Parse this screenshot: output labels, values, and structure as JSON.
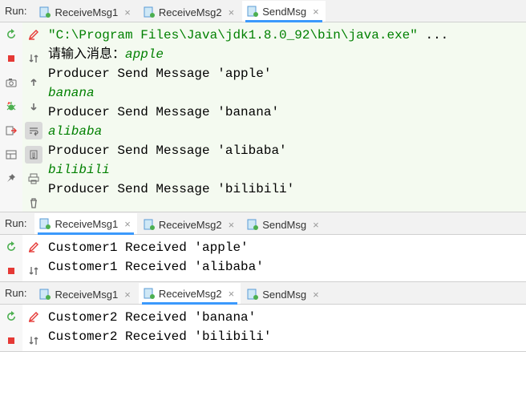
{
  "panels": [
    {
      "runLabel": "Run:",
      "tabs": [
        {
          "label": "ReceiveMsg1",
          "active": false
        },
        {
          "label": "ReceiveMsg2",
          "active": false
        },
        {
          "label": "SendMsg",
          "active": true
        }
      ],
      "hl": true,
      "leftTools": [
        "rerun",
        "stop",
        "camera",
        "bug",
        "exit",
        "layout",
        "pin"
      ],
      "rightTools": [
        "pen",
        "sort",
        "up",
        "down",
        "wrap",
        "scroll",
        "print",
        "trash"
      ],
      "selectedRight": [
        4,
        5
      ],
      "lines": [
        {
          "segs": [
            {
              "cls": "t-str",
              "text": "\"C:\\Program Files\\Java\\jdk1.8.0_92\\bin\\java.exe\""
            },
            {
              "cls": "t-black",
              "text": " ..."
            }
          ]
        },
        {
          "segs": [
            {
              "cls": "t-black",
              "text": "请输入消息："
            },
            {
              "cls": "t-green",
              "text": "apple"
            }
          ]
        },
        {
          "segs": [
            {
              "cls": "t-black",
              "text": "Producer Send Message 'apple'"
            }
          ]
        },
        {
          "segs": [
            {
              "cls": "t-green",
              "text": "banana"
            }
          ]
        },
        {
          "segs": [
            {
              "cls": "t-black",
              "text": "Producer Send Message 'banana'"
            }
          ]
        },
        {
          "segs": [
            {
              "cls": "t-green",
              "text": "alibaba"
            }
          ]
        },
        {
          "segs": [
            {
              "cls": "t-black",
              "text": "Producer Send Message 'alibaba'"
            }
          ]
        },
        {
          "segs": [
            {
              "cls": "t-green",
              "text": "bilibili"
            }
          ]
        },
        {
          "segs": [
            {
              "cls": "t-black",
              "text": "Producer Send Message 'bilibili'"
            }
          ]
        }
      ]
    },
    {
      "runLabel": "Run:",
      "tabs": [
        {
          "label": "ReceiveMsg1",
          "active": true
        },
        {
          "label": "ReceiveMsg2",
          "active": false
        },
        {
          "label": "SendMsg",
          "active": false
        }
      ],
      "hl": false,
      "leftTools": [
        "rerun",
        "stop"
      ],
      "rightTools": [
        "pen",
        "sort"
      ],
      "selectedRight": [],
      "lines": [
        {
          "segs": [
            {
              "cls": "t-black",
              "text": "Customer1 Received 'apple'"
            }
          ]
        },
        {
          "segs": [
            {
              "cls": "t-black",
              "text": "Customer1 Received 'alibaba'"
            }
          ]
        }
      ]
    },
    {
      "runLabel": "Run:",
      "tabs": [
        {
          "label": "ReceiveMsg1",
          "active": false
        },
        {
          "label": "ReceiveMsg2",
          "active": true
        },
        {
          "label": "SendMsg",
          "active": false
        }
      ],
      "hl": false,
      "leftTools": [
        "rerun",
        "stop"
      ],
      "rightTools": [
        "pen",
        "sort"
      ],
      "selectedRight": [],
      "lines": [
        {
          "segs": [
            {
              "cls": "t-black",
              "text": "Customer2 Received 'banana'"
            }
          ]
        },
        {
          "segs": [
            {
              "cls": "t-black",
              "text": "Customer2 Received 'bilibili'"
            }
          ]
        }
      ]
    }
  ]
}
